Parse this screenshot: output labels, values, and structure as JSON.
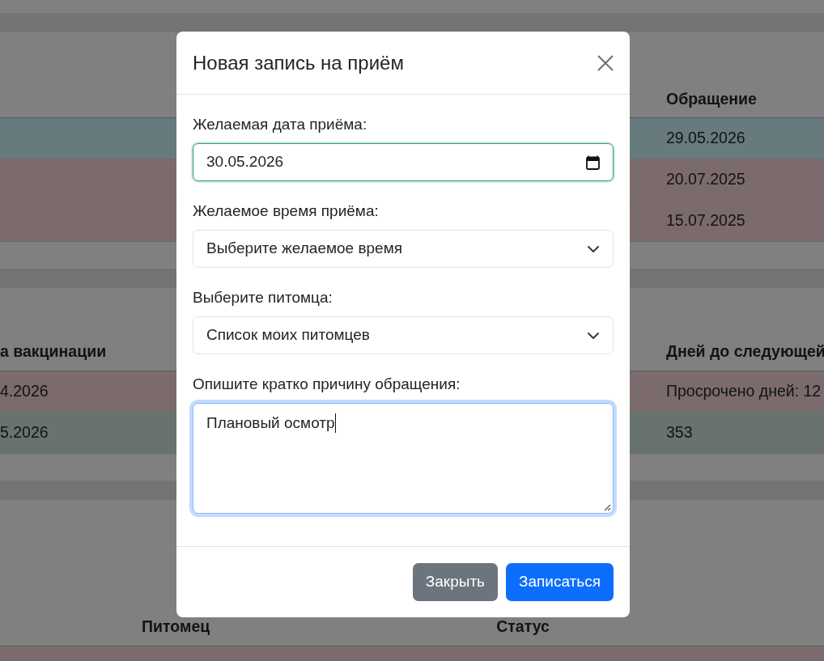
{
  "page": {
    "tables": [
      {
        "columns": [
          "Обращение"
        ],
        "rows": [
          {
            "color": "#677a7e",
            "cells": [
              "29.05.2026"
            ]
          },
          {
            "color": "#7c6b6d",
            "cells": [
              "20.07.2025"
            ]
          },
          {
            "color": "#7c6b6d",
            "cells": [
              "15.07.2025"
            ]
          }
        ]
      },
      {
        "columns": [
          "а вакцинации",
          "Дней до следующей"
        ],
        "rows": [
          {
            "color": "#7c6b6d",
            "cells": [
              "4.2026",
              "Просрочено дней: 12"
            ]
          },
          {
            "color": "#68736e",
            "cells": [
              "5.2026",
              "353"
            ]
          }
        ]
      },
      {
        "columns": [
          "Питомец",
          "Статус"
        ],
        "rows": [
          {
            "color": "#7c6b6d"
          }
        ]
      }
    ]
  },
  "modal": {
    "title": "Новая запись на приём",
    "fields": [
      {
        "kind": "date",
        "label": "Желаемая дата приёма:",
        "value": "30.05.2026",
        "valid": true
      },
      {
        "kind": "select",
        "label": "Желаемое время приёма:",
        "value": "Выберите желаемое время"
      },
      {
        "kind": "select",
        "label": "Выберите питомца:",
        "value": "Список моих питомцев"
      },
      {
        "kind": "textarea",
        "label": "Опишите кратко причину обращения:",
        "value": "Плановый осмотр",
        "focused": true
      }
    ],
    "buttons": [
      {
        "kind": "secondary",
        "label": "Закрыть"
      },
      {
        "kind": "primary",
        "label": "Записаться"
      }
    ]
  }
}
